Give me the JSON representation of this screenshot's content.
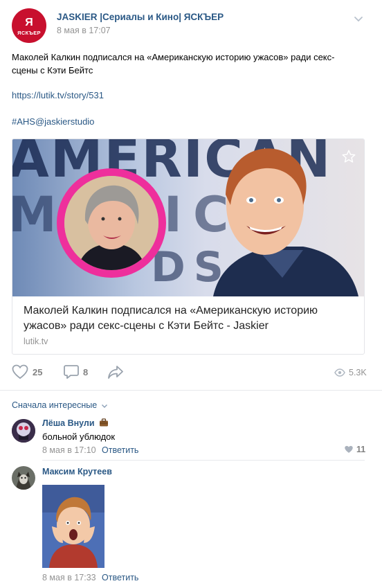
{
  "post": {
    "group_logo_big": "Я",
    "group_logo_small": "ЯСКЪЕР",
    "group_name": "JASKIER |Сериалы и Кино| ЯСКЪЕР",
    "date": "8 мая в 17:07",
    "text": "Маколей Калкин подписался на «Американскую историю ужасов» ради секс-сцены с Кэти Бейтс",
    "link": "https://lutik.tv/story/531",
    "hashtag": "#AHS@jaskierstudio"
  },
  "card": {
    "image_text_line1": "AMERICAN",
    "image_text_line2": "MUSIC",
    "image_text_line3": "DS",
    "caption": "Маколей Калкин подписался на «Американскую историю ужасов» ради секс-сцены с Кэти Бейтс - Jaskier",
    "domain": "lutik.tv"
  },
  "actions": {
    "likes": "25",
    "comments": "8",
    "views": "5.3K"
  },
  "comments_sort": "Сначала интересные",
  "comments": [
    {
      "author": "Лёша Внули",
      "text": "больной ублюдок",
      "date": "8 мая в 17:10",
      "reply": "Ответить",
      "likes": "11"
    },
    {
      "author": "Максим Крутеев",
      "date": "8 мая в 17:33",
      "reply": "Ответить"
    }
  ],
  "colors": {
    "link": "#2a5885",
    "logo": "#c8102e",
    "ring": "#ee2f9c"
  }
}
